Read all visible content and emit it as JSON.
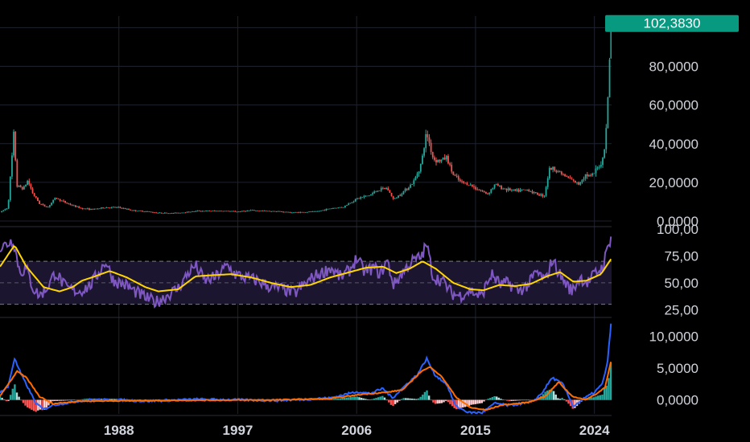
{
  "colors": {
    "background": "#000000",
    "up_candle": "#26a69a",
    "down_candle": "#ef5350",
    "rsi_line": "#7e57c2",
    "rsi_ma": "#ffd600",
    "rsi_band": "#1c1530",
    "macd_line": "#2962ff",
    "signal_line": "#ff6d00",
    "grid": "#1e222d",
    "price_tag": "#089981",
    "text": "#d1d4dc"
  },
  "chart_data": [
    {
      "type": "candlestick",
      "name": "price",
      "title": "",
      "x_ticks": [
        "1988",
        "1997",
        "2006",
        "2015",
        "2024"
      ],
      "x_tick_years": [
        1988,
        1997,
        2006,
        2015,
        2024
      ],
      "x_range": [
        1979,
        2025.3
      ],
      "y_ticks": [
        "0,0000",
        "20,0000",
        "40,0000",
        "60,0000",
        "80,0000"
      ],
      "y_tick_values": [
        0,
        20,
        40,
        60,
        80
      ],
      "ylim": [
        0,
        106
      ],
      "last_value": 102.383,
      "last_value_label": "102,3830",
      "points": [
        [
          1979.0,
          4.5
        ],
        [
          1979.6,
          7
        ],
        [
          1980.05,
          45
        ],
        [
          1980.3,
          18
        ],
        [
          1980.8,
          17
        ],
        [
          1981.1,
          21
        ],
        [
          1981.5,
          14
        ],
        [
          1982.0,
          9
        ],
        [
          1982.6,
          7
        ],
        [
          1983.2,
          12
        ],
        [
          1983.8,
          10
        ],
        [
          1984.5,
          8
        ],
        [
          1985.2,
          6.5
        ],
        [
          1986.0,
          6
        ],
        [
          1987.0,
          7
        ],
        [
          1988.0,
          7
        ],
        [
          1989.0,
          5.5
        ],
        [
          1990.0,
          5
        ],
        [
          1991.0,
          4.2
        ],
        [
          1992.0,
          4
        ],
        [
          1993.0,
          4.5
        ],
        [
          1994.0,
          5.2
        ],
        [
          1995.0,
          5.2
        ],
        [
          1996.0,
          5.2
        ],
        [
          1997.0,
          4.8
        ],
        [
          1998.0,
          5.5
        ],
        [
          1999.0,
          5.2
        ],
        [
          2000.0,
          5
        ],
        [
          2001.0,
          4.4
        ],
        [
          2002.0,
          4.6
        ],
        [
          2003.0,
          4.9
        ],
        [
          2004.0,
          6.5
        ],
        [
          2005.0,
          7.3
        ],
        [
          2006.0,
          11.5
        ],
        [
          2007.0,
          13.4
        ],
        [
          2007.6,
          16
        ],
        [
          2008.3,
          17
        ],
        [
          2008.8,
          11
        ],
        [
          2009.5,
          15
        ],
        [
          2010.3,
          20
        ],
        [
          2010.9,
          30
        ],
        [
          2011.3,
          46
        ],
        [
          2011.8,
          32
        ],
        [
          2012.3,
          31
        ],
        [
          2012.8,
          33
        ],
        [
          2013.3,
          24
        ],
        [
          2013.9,
          20
        ],
        [
          2014.5,
          19
        ],
        [
          2015.0,
          17
        ],
        [
          2015.9,
          14
        ],
        [
          2016.5,
          19
        ],
        [
          2017.0,
          17
        ],
        [
          2018.0,
          15.5
        ],
        [
          2019.0,
          16.2
        ],
        [
          2019.4,
          14.5
        ],
        [
          2020.2,
          13
        ],
        [
          2020.6,
          27
        ],
        [
          2021.0,
          27
        ],
        [
          2021.6,
          24
        ],
        [
          2022.3,
          21
        ],
        [
          2022.8,
          19
        ],
        [
          2023.3,
          24
        ],
        [
          2023.8,
          23
        ],
        [
          2024.2,
          27
        ],
        [
          2024.6,
          31
        ],
        [
          2024.8,
          40
        ],
        [
          2025.0,
          60
        ],
        [
          2025.15,
          84
        ],
        [
          2025.25,
          102.4
        ]
      ]
    },
    {
      "type": "line",
      "name": "rsi",
      "title": "",
      "y_ticks": [
        "25,00",
        "50,00",
        "75,00",
        "100,00"
      ],
      "y_tick_values": [
        25,
        50,
        75,
        100
      ],
      "ylim": [
        20,
        100
      ],
      "band": [
        30,
        70
      ],
      "midline": 50,
      "series_points": [
        [
          1979.0,
          82
        ],
        [
          1980.0,
          90
        ],
        [
          1980.5,
          60
        ],
        [
          1981.0,
          63
        ],
        [
          1981.5,
          45
        ],
        [
          1982.0,
          38
        ],
        [
          1982.6,
          46
        ],
        [
          1983.2,
          60
        ],
        [
          1984.0,
          45
        ],
        [
          1985.0,
          42
        ],
        [
          1985.8,
          47
        ],
        [
          1986.5,
          60
        ],
        [
          1987.0,
          70
        ],
        [
          1987.6,
          52
        ],
        [
          1988.5,
          48
        ],
        [
          1989.2,
          42
        ],
        [
          1990.2,
          35
        ],
        [
          1990.8,
          32
        ],
        [
          1991.5,
          37
        ],
        [
          1992.5,
          45
        ],
        [
          1993.3,
          60
        ],
        [
          1993.8,
          66
        ],
        [
          1994.5,
          52
        ],
        [
          1995.3,
          55
        ],
        [
          1996.2,
          66
        ],
        [
          1996.8,
          58
        ],
        [
          1997.5,
          55
        ],
        [
          1998.5,
          52
        ],
        [
          1999.5,
          46
        ],
        [
          2000.5,
          44
        ],
        [
          2001.3,
          40
        ],
        [
          2002.0,
          48
        ],
        [
          2002.8,
          56
        ],
        [
          2003.5,
          60
        ],
        [
          2004.0,
          64
        ],
        [
          2004.8,
          55
        ],
        [
          2005.5,
          62
        ],
        [
          2006.0,
          73
        ],
        [
          2006.6,
          60
        ],
        [
          2007.3,
          64
        ],
        [
          2007.8,
          58
        ],
        [
          2008.3,
          71
        ],
        [
          2008.8,
          48
        ],
        [
          2009.5,
          60
        ],
        [
          2010.2,
          70
        ],
        [
          2010.9,
          74
        ],
        [
          2011.3,
          86
        ],
        [
          2011.8,
          55
        ],
        [
          2012.5,
          52
        ],
        [
          2013.2,
          40
        ],
        [
          2013.8,
          38
        ],
        [
          2014.6,
          43
        ],
        [
          2015.4,
          37
        ],
        [
          2016.2,
          58
        ],
        [
          2016.9,
          48
        ],
        [
          2017.5,
          50
        ],
        [
          2018.2,
          42
        ],
        [
          2019.0,
          48
        ],
        [
          2019.6,
          60
        ],
        [
          2020.3,
          52
        ],
        [
          2020.8,
          72
        ],
        [
          2021.5,
          55
        ],
        [
          2022.3,
          42
        ],
        [
          2022.9,
          55
        ],
        [
          2023.5,
          50
        ],
        [
          2024.0,
          58
        ],
        [
          2024.6,
          64
        ],
        [
          2025.25,
          93
        ]
      ],
      "ma_points": [
        [
          1979.0,
          65
        ],
        [
          1980.1,
          85
        ],
        [
          1981.0,
          65
        ],
        [
          1982.3,
          46
        ],
        [
          1983.5,
          42
        ],
        [
          1984.5,
          46
        ],
        [
          1985.2,
          52
        ],
        [
          1986.2,
          56
        ],
        [
          1987.3,
          61
        ],
        [
          1988.6,
          55
        ],
        [
          1990.0,
          46
        ],
        [
          1991.0,
          42
        ],
        [
          1992.5,
          44
        ],
        [
          1993.8,
          56
        ],
        [
          1995.0,
          57
        ],
        [
          1996.5,
          58
        ],
        [
          1998.0,
          55
        ],
        [
          1999.5,
          50
        ],
        [
          2001.0,
          46
        ],
        [
          2002.5,
          48
        ],
        [
          2004.0,
          55
        ],
        [
          2005.5,
          60
        ],
        [
          2006.7,
          64
        ],
        [
          2008.0,
          65
        ],
        [
          2009.0,
          59
        ],
        [
          2010.0,
          63
        ],
        [
          2011.0,
          70
        ],
        [
          2012.0,
          63
        ],
        [
          2013.3,
          50
        ],
        [
          2014.6,
          44
        ],
        [
          2015.6,
          43
        ],
        [
          2016.8,
          48
        ],
        [
          2018.0,
          47
        ],
        [
          2019.2,
          49
        ],
        [
          2020.4,
          56
        ],
        [
          2021.4,
          60
        ],
        [
          2022.4,
          51
        ],
        [
          2023.4,
          52
        ],
        [
          2024.5,
          58
        ],
        [
          2025.25,
          72
        ]
      ]
    },
    {
      "type": "line",
      "name": "macd",
      "title": "",
      "y_ticks": [
        "0,0000",
        "5,0000",
        "10,0000"
      ],
      "y_tick_values": [
        0,
        5,
        10
      ],
      "ylim": [
        -2.2,
        12.6
      ],
      "macd_points": [
        [
          1979.0,
          1.2
        ],
        [
          1979.6,
          2
        ],
        [
          1980.1,
          6.5
        ],
        [
          1980.6,
          4
        ],
        [
          1981.1,
          2
        ],
        [
          1981.7,
          -0.5
        ],
        [
          1982.3,
          -1.5
        ],
        [
          1983.0,
          -0.8
        ],
        [
          1984.0,
          -0.5
        ],
        [
          1985.5,
          0
        ],
        [
          1988.0,
          0
        ],
        [
          1990.0,
          -0.2
        ],
        [
          1994.0,
          0.1
        ],
        [
          2000.0,
          -0.1
        ],
        [
          2004.0,
          0.3
        ],
        [
          2006.0,
          1.3
        ],
        [
          2007.0,
          1
        ],
        [
          2008.0,
          1.8
        ],
        [
          2008.7,
          0.3
        ],
        [
          2009.8,
          2.5
        ],
        [
          2010.6,
          4
        ],
        [
          2011.3,
          6.5
        ],
        [
          2011.9,
          4
        ],
        [
          2012.8,
          2.5
        ],
        [
          2013.5,
          -1
        ],
        [
          2014.5,
          -2
        ],
        [
          2015.5,
          -2
        ],
        [
          2016.5,
          -0.5
        ],
        [
          2017.5,
          -0.9
        ],
        [
          2019.3,
          -0.3
        ],
        [
          2020.0,
          1
        ],
        [
          2020.8,
          3.5
        ],
        [
          2021.6,
          2.5
        ],
        [
          2022.4,
          -1
        ],
        [
          2023.2,
          0.2
        ],
        [
          2024.0,
          1.2
        ],
        [
          2024.6,
          2.5
        ],
        [
          2025.0,
          6
        ],
        [
          2025.25,
          12
        ]
      ],
      "signal_points": [
        [
          1979.0,
          0.6
        ],
        [
          1980.3,
          4.5
        ],
        [
          1981.0,
          3.5
        ],
        [
          1982.0,
          0.5
        ],
        [
          1983.0,
          -0.6
        ],
        [
          1985.0,
          -0.2
        ],
        [
          1990.0,
          -0.1
        ],
        [
          2000.0,
          0
        ],
        [
          2004.0,
          0.2
        ],
        [
          2006.5,
          0.9
        ],
        [
          2008.3,
          1.2
        ],
        [
          2009.5,
          1.6
        ],
        [
          2010.9,
          4.5
        ],
        [
          2011.6,
          5.2
        ],
        [
          2012.5,
          3.5
        ],
        [
          2013.5,
          0.5
        ],
        [
          2014.6,
          -1.2
        ],
        [
          2015.8,
          -1.6
        ],
        [
          2017.0,
          -0.8
        ],
        [
          2019.0,
          -0.4
        ],
        [
          2020.3,
          0.6
        ],
        [
          2021.3,
          2.8
        ],
        [
          2022.3,
          0.6
        ],
        [
          2023.3,
          0
        ],
        [
          2024.2,
          1
        ],
        [
          2024.8,
          2
        ],
        [
          2025.25,
          6
        ]
      ]
    }
  ]
}
